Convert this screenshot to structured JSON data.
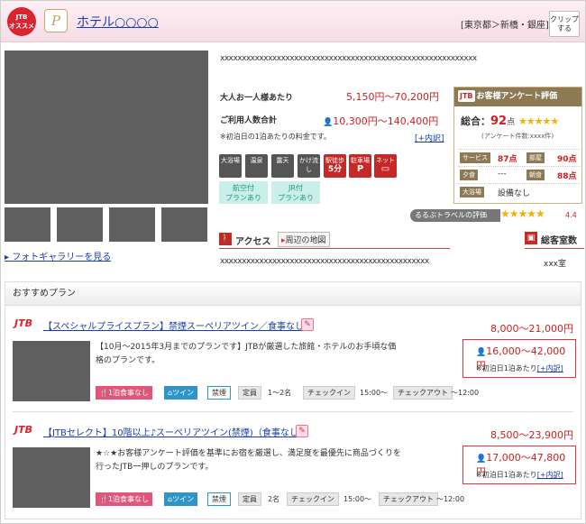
{
  "header": {
    "badge_line1": "JTB",
    "badge_line2": "オススメ",
    "logo_glyph": "P",
    "hotel_name": "ホテル○○○○",
    "area": "[東京都＞新橋・銀座]",
    "clip_line1": "クリップ",
    "clip_line2": "する"
  },
  "gallery": {
    "link": "フォトギャラリーを見る"
  },
  "description": "xxxxxxxxxxxxxxxxxxxxxxxxxxxxxxxxxxxxxxxxxxxxxxxxxxxxxxxxxxx",
  "prices": {
    "per_adult_label": "大人お一人様あたり",
    "per_adult_value": "5,150円〜70,200円",
    "total_label": "ご利用人数合計",
    "total_value": "10,300円〜140,400円",
    "note": "※初泊日の1泊あたりの料金です。",
    "breakdown_link": "[+内訳]"
  },
  "facilities": [
    {
      "line1": "大浴場",
      "line2": ""
    },
    {
      "line1": "温泉",
      "line2": ""
    },
    {
      "line1": "露天",
      "line2": ""
    },
    {
      "line1": "かけ流し",
      "line2": ""
    },
    {
      "line1": "駅徒歩",
      "line2": "5分"
    },
    {
      "line1": "駐車場",
      "line2": "P"
    },
    {
      "line1": "ネット",
      "line2": "▭"
    }
  ],
  "plan_tags": [
    {
      "line1": "航空付",
      "line2": "プランあり"
    },
    {
      "line1": "JR付",
      "line2": "プランあり"
    }
  ],
  "survey": {
    "logo": "JTB",
    "title": "お客様アンケート評価",
    "overall_label": "総合：",
    "overall_value": "92",
    "overall_unit": "点",
    "stars": "★★★★★",
    "count": "(アンケート件数:xxxx件)",
    "rows": [
      {
        "a_label": "サービス",
        "a_value": "87点",
        "b_label": "部屋",
        "b_value": "90点"
      },
      {
        "a_label": "夕食",
        "a_value": "---",
        "b_label": "朝食",
        "b_value": "88点"
      },
      {
        "a_label": "大浴場",
        "a_value": "設備なし",
        "b_label": "",
        "b_value": ""
      }
    ]
  },
  "rurubu": {
    "label": "るるぶトラベルの評価",
    "stars": "★★★★★",
    "score": "4.4"
  },
  "access": {
    "label": "アクセス",
    "map_button": "周辺の地図",
    "text": "xxxxxxxxxxxxxxxxxxxxxxxxxxxxxxxxxxxxxxxxxxxxxxxx"
  },
  "rooms": {
    "label": "総客室数",
    "value": "xxx室"
  },
  "recommended": {
    "title": "おすすめプラン",
    "plans": [
      {
        "brand": "JTB",
        "title": "【スペシャルプライスプラン】禁煙スーペリアツイン／食事なし",
        "range": "8,000〜21,000円",
        "desc_line1": "【10月〜2015年3月までのプランです】JTBが厳選した旅館・ホテルのお手頃な価",
        "desc_line2": "格のプランです。",
        "price": "16,000〜42,000円",
        "price_note": "※初泊日1泊あたり",
        "breakdown": "[+内訳]",
        "meal": "1泊食事なし",
        "room": "ツイン",
        "smoke": "禁煙",
        "capacity_label": "定員",
        "capacity": "1〜2名",
        "checkin_label": "チェックイン",
        "checkin": "15:00〜",
        "checkout_label": "チェックアウト",
        "checkout": "〜12:00"
      },
      {
        "brand": "JTB",
        "title": "【JTBセレクト】10階以上♪スーペリアツイン(禁煙)（食事なし）",
        "range": "8,500〜23,900円",
        "desc_line1": "★☆★お客様アンケート評価を基準にお宿を厳選し、満足度を最優先に商品づくりを",
        "desc_line2": "行ったJTB一押しのプランです。",
        "price": "17,000〜47,800円",
        "price_note": "※初泊日1泊あたり",
        "breakdown": "[+内訳]",
        "meal": "1泊食事なし",
        "room": "ツイン",
        "smoke": "禁煙",
        "capacity_label": "定員",
        "capacity": "2名",
        "checkin_label": "チェックイン",
        "checkin": "15:00〜",
        "checkout_label": "チェックアウト",
        "checkout": "〜12:00"
      }
    ]
  }
}
